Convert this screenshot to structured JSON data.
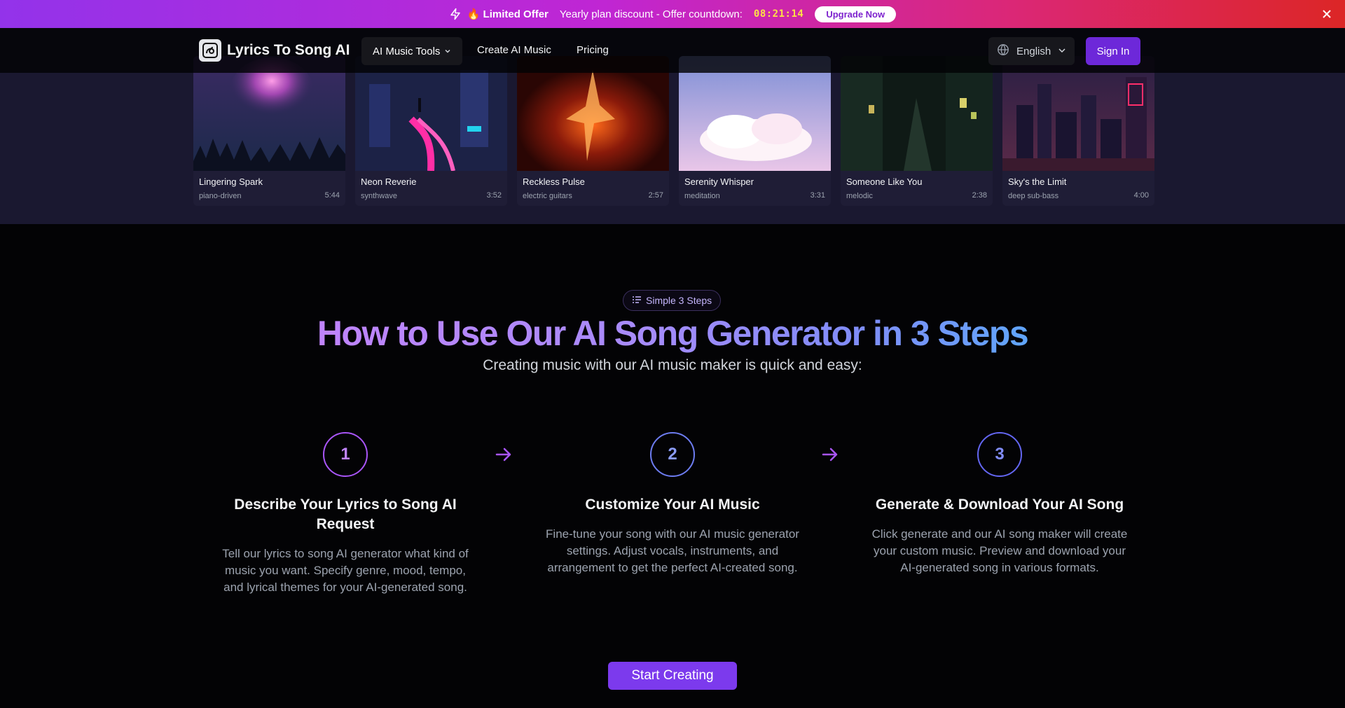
{
  "promo": {
    "label": "Limited Offer",
    "description": "Yearly plan discount - Offer countdown:",
    "timer": "08:21:14",
    "button": "Upgrade Now"
  },
  "header": {
    "brand": "Lyrics To Song AI",
    "tools_label": "AI Music Tools",
    "create_label": "Create AI Music",
    "pricing_label": "Pricing",
    "language": "English",
    "signin": "Sign In"
  },
  "songs": [
    {
      "title": "Lingering Spark",
      "genre": "piano-driven",
      "duration": "5:44"
    },
    {
      "title": "Neon Reverie",
      "genre": "synthwave",
      "duration": "3:52"
    },
    {
      "title": "Reckless Pulse",
      "genre": "electric guitars",
      "duration": "2:57"
    },
    {
      "title": "Serenity Whisper",
      "genre": "meditation",
      "duration": "3:31"
    },
    {
      "title": "Someone Like You",
      "genre": "melodic",
      "duration": "2:38"
    },
    {
      "title": "Sky's the Limit",
      "genre": "deep sub-bass",
      "duration": "4:00"
    }
  ],
  "steps_section": {
    "badge": "Simple 3 Steps",
    "title": "How to Use Our AI Song Generator in 3 Steps",
    "subtitle": "Creating music with our AI music maker is quick and easy:",
    "steps": [
      {
        "number": "1",
        "title": "Describe Your Lyrics to Song AI Request",
        "text": "Tell our lyrics to song AI generator what kind of music you want. Specify genre, mood, tempo, and lyrical themes for your AI-generated song."
      },
      {
        "number": "2",
        "title": "Customize Your AI Music",
        "text": "Fine-tune your song with our AI music generator settings. Adjust vocals, instruments, and arrangement to get the perfect AI-created song."
      },
      {
        "number": "3",
        "title": "Generate & Download Your AI Song",
        "text": "Click generate and our AI song maker will create your custom music. Preview and download your AI-generated song in various formats."
      }
    ],
    "cta": "Start Creating"
  },
  "colors": {
    "accent": "#7c3aed",
    "step1": "#a855f7",
    "step2": "#6d7cf0",
    "step3": "#6366f1",
    "timer": "#fde047"
  }
}
